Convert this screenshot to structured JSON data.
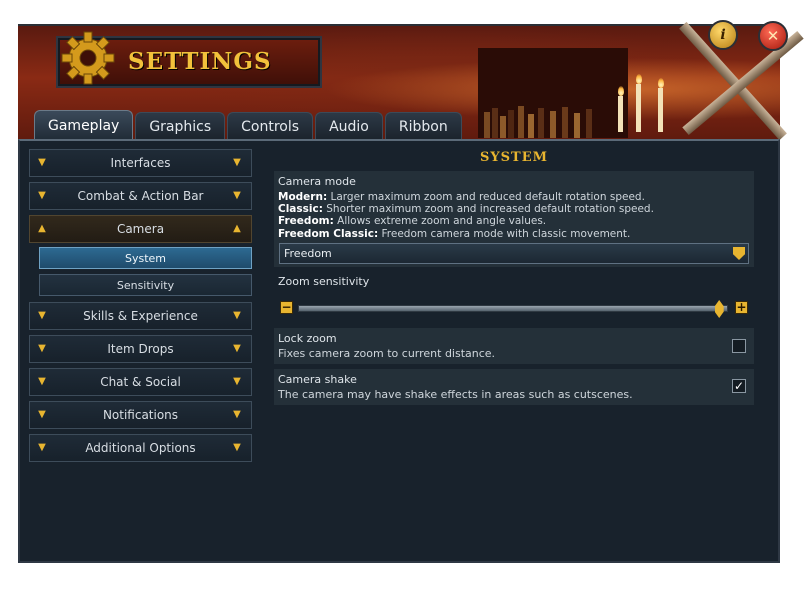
{
  "window": {
    "title": "SETTINGS",
    "icons": {
      "logo": "gear-icon",
      "info": "info-icon",
      "close": "close-icon"
    },
    "info_glyph": "i",
    "close_glyph": "✕"
  },
  "tabs": [
    {
      "label": "Gameplay",
      "active": true
    },
    {
      "label": "Graphics",
      "active": false
    },
    {
      "label": "Controls",
      "active": false
    },
    {
      "label": "Audio",
      "active": false
    },
    {
      "label": "Ribbon",
      "active": false
    }
  ],
  "sidebar": {
    "items": [
      {
        "label": "Interfaces"
      },
      {
        "label": "Combat & Action Bar"
      },
      {
        "label": "Camera",
        "expanded": true
      },
      {
        "label": "Skills & Experience"
      },
      {
        "label": "Item Drops"
      },
      {
        "label": "Chat & Social"
      },
      {
        "label": "Notifications"
      },
      {
        "label": "Additional Options"
      }
    ],
    "camera_subitems": [
      {
        "label": "System",
        "selected": true
      },
      {
        "label": "Sensitivity",
        "selected": false
      }
    ]
  },
  "main": {
    "section_title": "SYSTEM",
    "camera_mode": {
      "label": "Camera mode",
      "options": [
        {
          "name": "Modern:",
          "text": " Larger maximum zoom and reduced default rotation speed."
        },
        {
          "name": "Classic:",
          "text": " Shorter maximum zoom and increased default rotation speed."
        },
        {
          "name": "Freedom:",
          "text": " Allows extreme zoom and angle values."
        },
        {
          "name": "Freedom Classic:",
          "text": " Freedom camera mode with classic movement."
        }
      ],
      "selected": "Freedom"
    },
    "zoom_sensitivity": {
      "label": "Zoom sensitivity",
      "value_fraction": 0.99,
      "minus": "−",
      "plus": "+"
    },
    "lock_zoom": {
      "label": "Lock zoom",
      "description": "Fixes camera zoom to current distance.",
      "checked": false
    },
    "camera_shake": {
      "label": "Camera shake",
      "description": "The camera may have shake effects in areas such as cutscenes.",
      "checked": true,
      "check_glyph": "✓"
    }
  },
  "colors": {
    "accent": "#e8b530",
    "panel": "#18222c",
    "selected": "#2d6a92"
  }
}
